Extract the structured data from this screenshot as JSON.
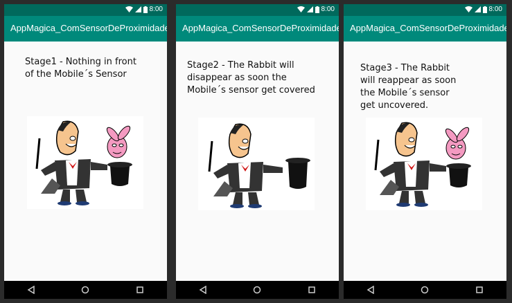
{
  "phones": [
    {
      "status_time": "8:00",
      "app_title": "AppMagica_ComSensorDeProximidade",
      "description": "Stage1 - Nothing in front of the Mobile´s Sensor",
      "rabbit_visible": true
    },
    {
      "status_time": "8:00",
      "app_title": "AppMagica_ComSensorDeProximidade",
      "description": "Stage2 - The Rabbit will disappear as soon the Mobile´s sensor get covered",
      "rabbit_visible": false
    },
    {
      "status_time": "8:00",
      "app_title": "AppMagica_ComSensorDeProximidade",
      "description": "Stage3 - The Rabbit will reappear as soon the Mobile´s sensor get uncovered.",
      "rabbit_visible": true
    }
  ],
  "icons": {
    "wifi": "wifi-icon",
    "signal": "signal-icon",
    "battery": "battery-icon",
    "back": "back-icon",
    "home": "home-icon",
    "recents": "recents-icon"
  },
  "colors": {
    "status_bar": "#00695c",
    "app_bar": "#00897b",
    "nav_bar": "#000000"
  }
}
